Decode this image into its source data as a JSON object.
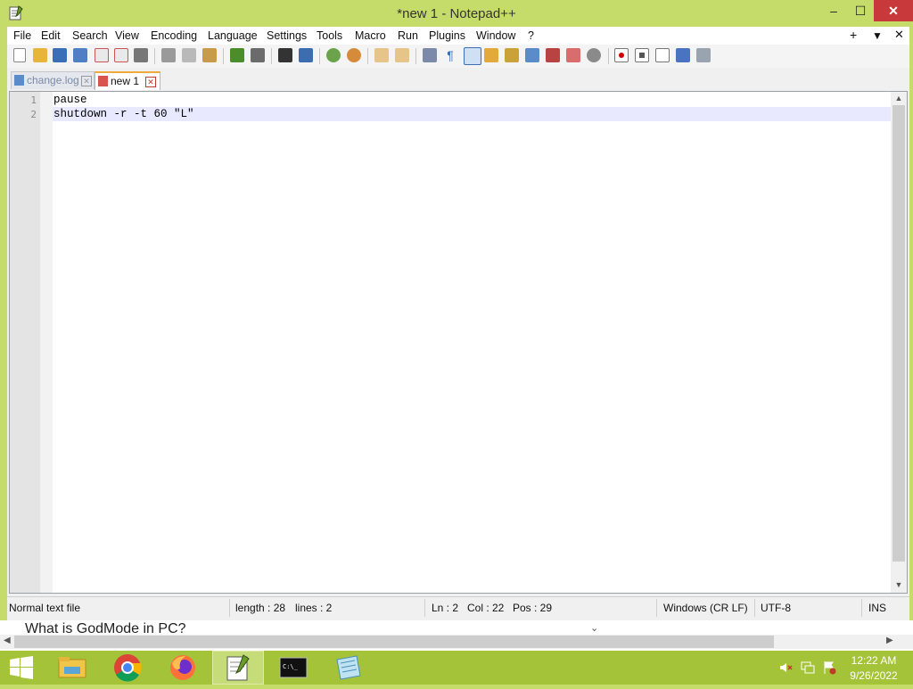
{
  "window": {
    "title": "*new 1 - Notepad++",
    "minimize": "–",
    "maximize": "☐",
    "close": "✕"
  },
  "menu": {
    "items": [
      "File",
      "Edit",
      "Search",
      "View",
      "Encoding",
      "Language",
      "Settings",
      "Tools",
      "Macro",
      "Run",
      "Plugins",
      "Window",
      "?"
    ],
    "plus": "+",
    "dropdown": "▼",
    "close": "✕"
  },
  "tabs": [
    {
      "label": "change.log",
      "close": "✕"
    },
    {
      "label": "new 1",
      "close": "✕"
    }
  ],
  "editor": {
    "lines": [
      {
        "num": "1",
        "text": "pause"
      },
      {
        "num": "2",
        "text": "shutdown -r -t 60 \"L\""
      }
    ],
    "current_line": 2
  },
  "status": {
    "type": "Normal text file",
    "length": "length : 28",
    "lines": "lines : 2",
    "ln": "Ln : 2",
    "col": "Col : 22",
    "pos": "Pos : 29",
    "eol": "Windows (CR LF)",
    "encoding": "UTF-8",
    "mode": "INS"
  },
  "background_page": {
    "text": "What is GodMode in PC?"
  },
  "taskbar": {
    "time": "12:22 AM",
    "date": "9/26/2022"
  },
  "colors": {
    "accent": "#c6dc6a",
    "taskbar": "#a4c339",
    "current_line": "#e8e8ff",
    "close_button": "#c8393b"
  }
}
